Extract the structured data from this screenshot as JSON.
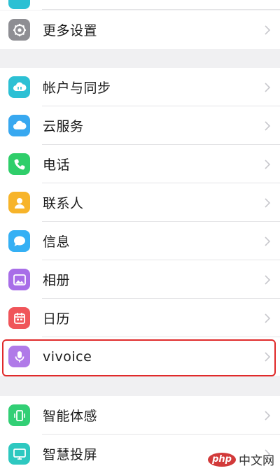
{
  "top_group": {
    "items": [
      {
        "label": "更多设置",
        "icon": "gear-icon",
        "color": "#8e8e93"
      }
    ]
  },
  "apps_group": {
    "items": [
      {
        "label": "帐户与同步",
        "icon": "cloud-sync-icon",
        "color": "#2cc0d4"
      },
      {
        "label": "云服务",
        "icon": "cloud-icon",
        "color": "#38a8f0"
      },
      {
        "label": "电话",
        "icon": "phone-icon",
        "color": "#2fce6a"
      },
      {
        "label": "联系人",
        "icon": "person-icon",
        "color": "#f7b42a"
      },
      {
        "label": "信息",
        "icon": "message-icon",
        "color": "#35b0f4"
      },
      {
        "label": "相册",
        "icon": "photo-icon",
        "color": "#a86ee8"
      },
      {
        "label": "日历",
        "icon": "calendar-icon",
        "color": "#f0555a"
      },
      {
        "label": "vivoice",
        "icon": "microphone-icon",
        "color": "#b07ae8"
      }
    ]
  },
  "bottom_group": {
    "items": [
      {
        "label": "智能体感",
        "icon": "phone-motion-icon",
        "color": "#32cf75"
      },
      {
        "label": "智慧投屏",
        "icon": "screen-cast-icon",
        "color": "#2ec8c0"
      }
    ]
  },
  "watermark": {
    "logo": "php",
    "text": "中文网"
  }
}
